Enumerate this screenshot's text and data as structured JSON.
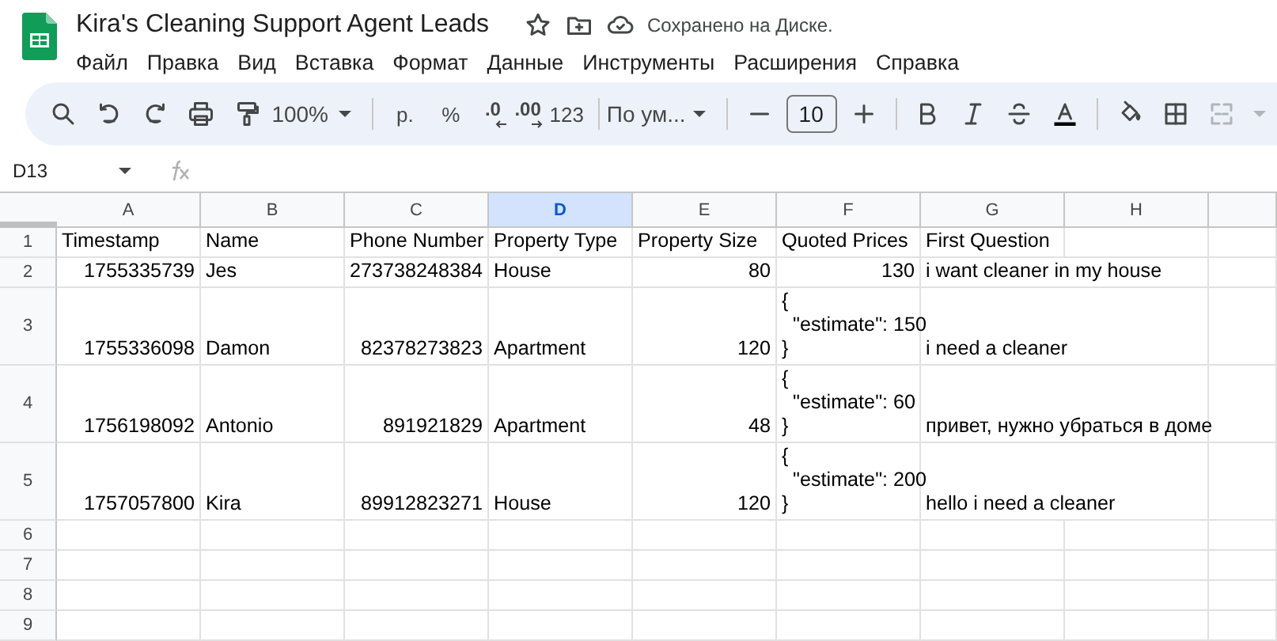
{
  "document": {
    "title": "Kira's Cleaning Support Agent Leads",
    "save_status": "Сохранено на Диске."
  },
  "menu": [
    "Файл",
    "Правка",
    "Вид",
    "Вставка",
    "Формат",
    "Данные",
    "Инструменты",
    "Расширения",
    "Справка"
  ],
  "toolbar": [
    {
      "kind": "search",
      "disabled": false
    },
    {
      "kind": "undo",
      "disabled": false
    },
    {
      "kind": "redo",
      "disabled": false
    },
    {
      "kind": "print",
      "disabled": false
    },
    {
      "kind": "paintformat",
      "disabled": false
    },
    {
      "kind": "dropdown",
      "text": "100%",
      "disabled": false
    },
    {
      "kind": "separator"
    },
    {
      "kind": "text",
      "text": "р.",
      "disabled": false
    },
    {
      "kind": "text",
      "text": "%",
      "disabled": false
    },
    {
      "kind": "decless",
      "text": ".0",
      "disabled": false
    },
    {
      "kind": "decmore",
      "text": ".00",
      "disabled": false
    },
    {
      "kind": "text",
      "text": "123",
      "disabled": false
    },
    {
      "kind": "separator"
    },
    {
      "kind": "dropdown",
      "text": "По ум...",
      "disabled": false
    },
    {
      "kind": "separator"
    },
    {
      "kind": "minus",
      "disabled": false
    },
    {
      "kind": "field",
      "text": "10",
      "disabled": false
    },
    {
      "kind": "plus",
      "disabled": false
    },
    {
      "kind": "separator"
    },
    {
      "kind": "bold",
      "disabled": false
    },
    {
      "kind": "italic",
      "disabled": false
    },
    {
      "kind": "strike",
      "disabled": false
    },
    {
      "kind": "textcolor",
      "disabled": false
    },
    {
      "kind": "separator"
    },
    {
      "kind": "fill",
      "disabled": false
    },
    {
      "kind": "borders",
      "disabled": false
    },
    {
      "kind": "merge",
      "disabled": true
    }
  ],
  "formula_bar": {
    "cell_ref": "D13"
  },
  "grid": {
    "columns": [
      {
        "label": "A",
        "selected": false
      },
      {
        "label": "B",
        "selected": false
      },
      {
        "label": "C",
        "selected": false
      },
      {
        "label": "D",
        "selected": true
      },
      {
        "label": "E",
        "selected": false
      },
      {
        "label": "F",
        "selected": false
      },
      {
        "label": "G",
        "selected": false
      },
      {
        "label": "H",
        "selected": false
      }
    ],
    "rows": [
      {
        "number": "1",
        "cells": [
          {
            "text": "Timestamp",
            "kind": "text"
          },
          {
            "text": "Name",
            "kind": "text"
          },
          {
            "text": "Phone Number",
            "kind": "text"
          },
          {
            "text": "Property Type",
            "kind": "text"
          },
          {
            "text": "Property Size",
            "kind": "text"
          },
          {
            "text": "Quoted Prices",
            "kind": "text"
          },
          {
            "text": "First Question",
            "kind": "text"
          }
        ]
      },
      {
        "number": "2",
        "cells": [
          {
            "text": "1755335739",
            "kind": "number"
          },
          {
            "text": "Jes",
            "kind": "text"
          },
          {
            "text": "273738248384",
            "kind": "number"
          },
          {
            "text": "House",
            "kind": "text"
          },
          {
            "text": "80",
            "kind": "number"
          },
          {
            "text": "130",
            "kind": "number"
          },
          {
            "text": "i want cleaner in my house",
            "kind": "text"
          }
        ]
      },
      {
        "number": "3",
        "cells": [
          {
            "text": "1755336098",
            "kind": "number"
          },
          {
            "text": "Damon",
            "kind": "text"
          },
          {
            "text": "82378273823",
            "kind": "number"
          },
          {
            "text": "Apartment",
            "kind": "text"
          },
          {
            "text": "120",
            "kind": "number"
          },
          {
            "text": "{\n  \"estimate\": 150\n}",
            "kind": "text"
          },
          {
            "text": "i need a cleaner",
            "kind": "text"
          }
        ]
      },
      {
        "number": "4",
        "cells": [
          {
            "text": "1756198092",
            "kind": "number"
          },
          {
            "text": "Antonio",
            "kind": "text"
          },
          {
            "text": "891921829",
            "kind": "number"
          },
          {
            "text": "Apartment",
            "kind": "text"
          },
          {
            "text": "48",
            "kind": "number"
          },
          {
            "text": "{\n  \"estimate\": 60\n}",
            "kind": "text"
          },
          {
            "text": "привет, нужно убраться в доме",
            "kind": "text"
          }
        ]
      },
      {
        "number": "5",
        "cells": [
          {
            "text": "1757057800",
            "kind": "number"
          },
          {
            "text": "Kira",
            "kind": "text"
          },
          {
            "text": "89912823271",
            "kind": "number"
          },
          {
            "text": "House",
            "kind": "text"
          },
          {
            "text": "120",
            "kind": "number"
          },
          {
            "text": "{\n  \"estimate\": 200\n}",
            "kind": "text"
          },
          {
            "text": "hello i need a cleaner",
            "kind": "text"
          }
        ]
      },
      {
        "number": "6"
      },
      {
        "number": "7"
      },
      {
        "number": "8"
      },
      {
        "number": "9"
      }
    ]
  }
}
